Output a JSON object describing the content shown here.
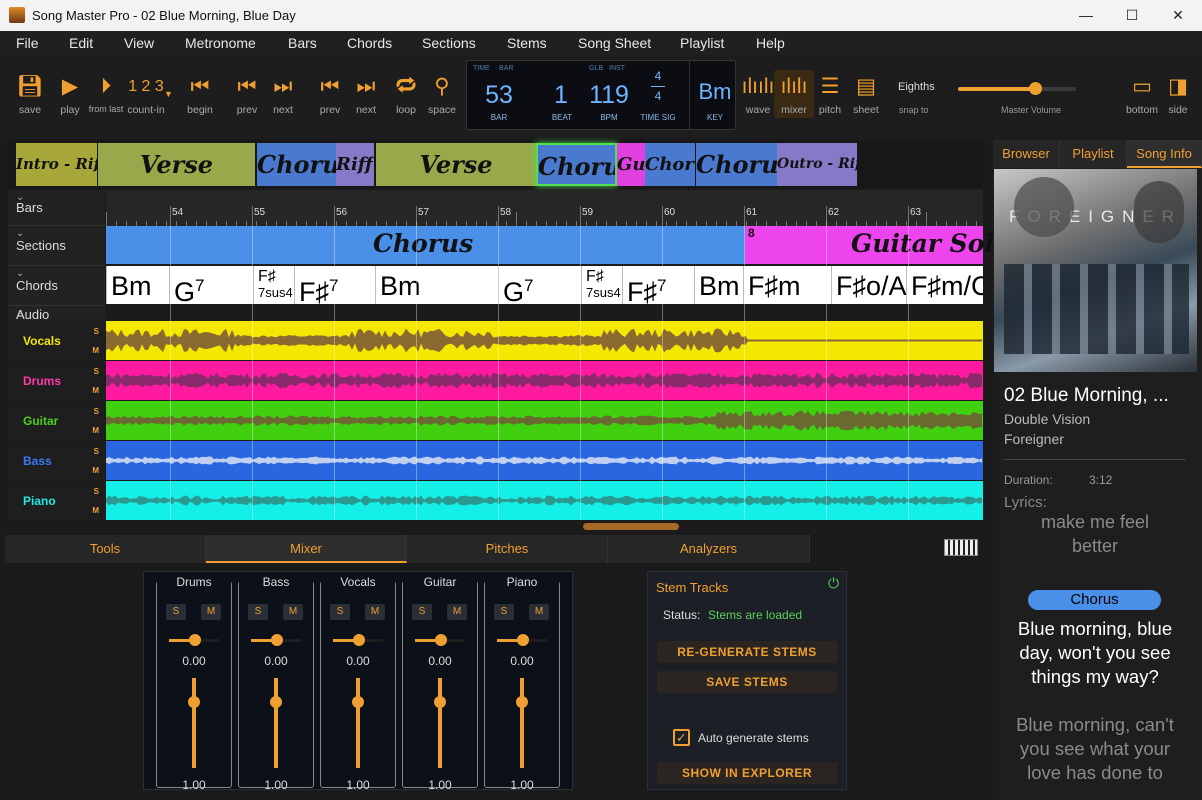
{
  "window": {
    "title": "Song Master Pro - 02 Blue Morning, Blue Day",
    "minimize": "—",
    "maximize": "☐",
    "close": "✕"
  },
  "menu": [
    "File",
    "Edit",
    "View",
    "Metronome",
    "Bars",
    "Chords",
    "Sections",
    "Stems",
    "Song Sheet",
    "Playlist",
    "Help"
  ],
  "toolbar": {
    "save": "save",
    "play": "play",
    "from_last": "from last",
    "count_in": "count-in",
    "count_in_glyph": "1 2 3",
    "begin": "begin",
    "prev_bar": "prev",
    "next_bar": "next",
    "prev_sec": "prev",
    "next_sec": "next",
    "loop": "loop",
    "space": "space",
    "wave": "wave",
    "mixer": "mixer",
    "pitch": "pitch",
    "sheet": "sheet",
    "snap_value": "Eighths",
    "snap_label": "snap to",
    "master_volume": "Master Volume",
    "master_volume_level": 0.65,
    "bottom": "bottom",
    "side": "side"
  },
  "lcd": {
    "time": "TIME",
    "bar_top": "BAR",
    "glb": "GLB",
    "inst": "INST",
    "bar": "53",
    "bar_label": "BAR",
    "beat": "1",
    "beat_label": "BEAT",
    "bpm": "119",
    "bpm_label": "BPM",
    "ts_top": "4",
    "ts_bottom": "4",
    "ts_label": "TIME SIG",
    "key": "Bm",
    "key_label": "KEY"
  },
  "section_strip": [
    {
      "label": "Intro - Riff A",
      "color": "#a8a83a"
    },
    {
      "label": "Verse",
      "color": "#9aa84c"
    },
    {
      "label": "Chorus",
      "color": "#4a7ad0"
    },
    {
      "label": "Riff A",
      "color": "#8878c8"
    },
    {
      "label": "Verse",
      "color": "#9aa84c"
    },
    {
      "label": "Chorus",
      "color": "#4a7ad0"
    },
    {
      "label": "Guitar Solo",
      "color": "#e040e0"
    },
    {
      "label": "Chorus",
      "color": "#4a7ad0"
    },
    {
      "label": "Chorus - variation",
      "color": "#4a7ad0"
    },
    {
      "label": "Outro - Riff A",
      "color": "#8878c8"
    }
  ],
  "rows": {
    "bars": "Bars",
    "sections": "Sections",
    "chords": "Chords",
    "audio": "Audio"
  },
  "bar_numbers": [
    "54",
    "55",
    "56",
    "57",
    "58",
    "59",
    "60",
    "61",
    "62",
    "63"
  ],
  "sections_row": {
    "chorus": "Chorus",
    "solo_marker": "8",
    "solo": "Guitar Solo"
  },
  "chords": [
    {
      "root": "Bm",
      "ext": ""
    },
    {
      "root": "G",
      "ext": "7"
    },
    {
      "root": "F♯",
      "ext": "7sus4"
    },
    {
      "root": "F♯",
      "ext": "7"
    },
    {
      "root": "Bm",
      "ext": ""
    },
    {
      "root": "G",
      "ext": "7"
    },
    {
      "root": "F♯",
      "ext": "7sus4"
    },
    {
      "root": "F♯",
      "ext": "7"
    },
    {
      "root": "Bm",
      "ext": ""
    },
    {
      "root": "F♯m",
      "ext": ""
    },
    {
      "root": "F♯o/A",
      "ext": ""
    },
    {
      "root": "F♯m/C",
      "ext": ""
    }
  ],
  "tracks": [
    {
      "name": "Vocals",
      "color": "#f5e800",
      "label_color": "#f5e800",
      "wave": "#8a6a30"
    },
    {
      "name": "Drums",
      "color": "#ff1aa0",
      "label_color": "#ff3aa8",
      "wave": "#8a2a6a"
    },
    {
      "name": "Guitar",
      "color": "#40d010",
      "label_color": "#50d020",
      "wave": "#6a6a30"
    },
    {
      "name": "Bass",
      "color": "#2a66e0",
      "label_color": "#3a78f0",
      "wave": "#c0d0f0"
    },
    {
      "name": "Piano",
      "color": "#14f0e8",
      "label_color": "#20e8e0",
      "wave": "#2a9a90"
    }
  ],
  "solo_btn": "S",
  "mute_btn": "M",
  "bottom_tabs": [
    "Tools",
    "Mixer",
    "Pitches",
    "Analyzers"
  ],
  "mixer": [
    {
      "name": "Drums",
      "pan": "0.00",
      "volume": "1.00"
    },
    {
      "name": "Bass",
      "pan": "0.00",
      "volume": "1.00"
    },
    {
      "name": "Vocals",
      "pan": "0.00",
      "volume": "1.00"
    },
    {
      "name": "Guitar",
      "pan": "0.00",
      "volume": "1.00"
    },
    {
      "name": "Piano",
      "pan": "0.00",
      "volume": "1.00"
    }
  ],
  "stem": {
    "title": "Stem Tracks",
    "status_label": "Status:",
    "status_value": "Stems are loaded",
    "regen": "RE-GENERATE STEMS",
    "save": "SAVE STEMS",
    "auto": "Auto generate stems",
    "auto_checked": true,
    "explorer": "SHOW IN EXPLORER"
  },
  "right_tabs": [
    "Browser",
    "Playlist",
    "Song Info"
  ],
  "album_art_text": "FOREIGNER",
  "song": {
    "title": "02 Blue Morning, ...",
    "album": "Double Vision",
    "artist": "Foreigner",
    "duration_label": "Duration:",
    "duration": "3:12",
    "lyrics_label": "Lyrics:",
    "prev_line": "make me feel better",
    "section": "Chorus",
    "current_line": "Blue morning, blue day, won't you see things my way?",
    "next_line": "Blue morning, can't you see what your love has done to"
  },
  "colors": {
    "accent": "#f0a030",
    "lcd": "#6fb2ff",
    "status_ok": "#5ad05a"
  }
}
